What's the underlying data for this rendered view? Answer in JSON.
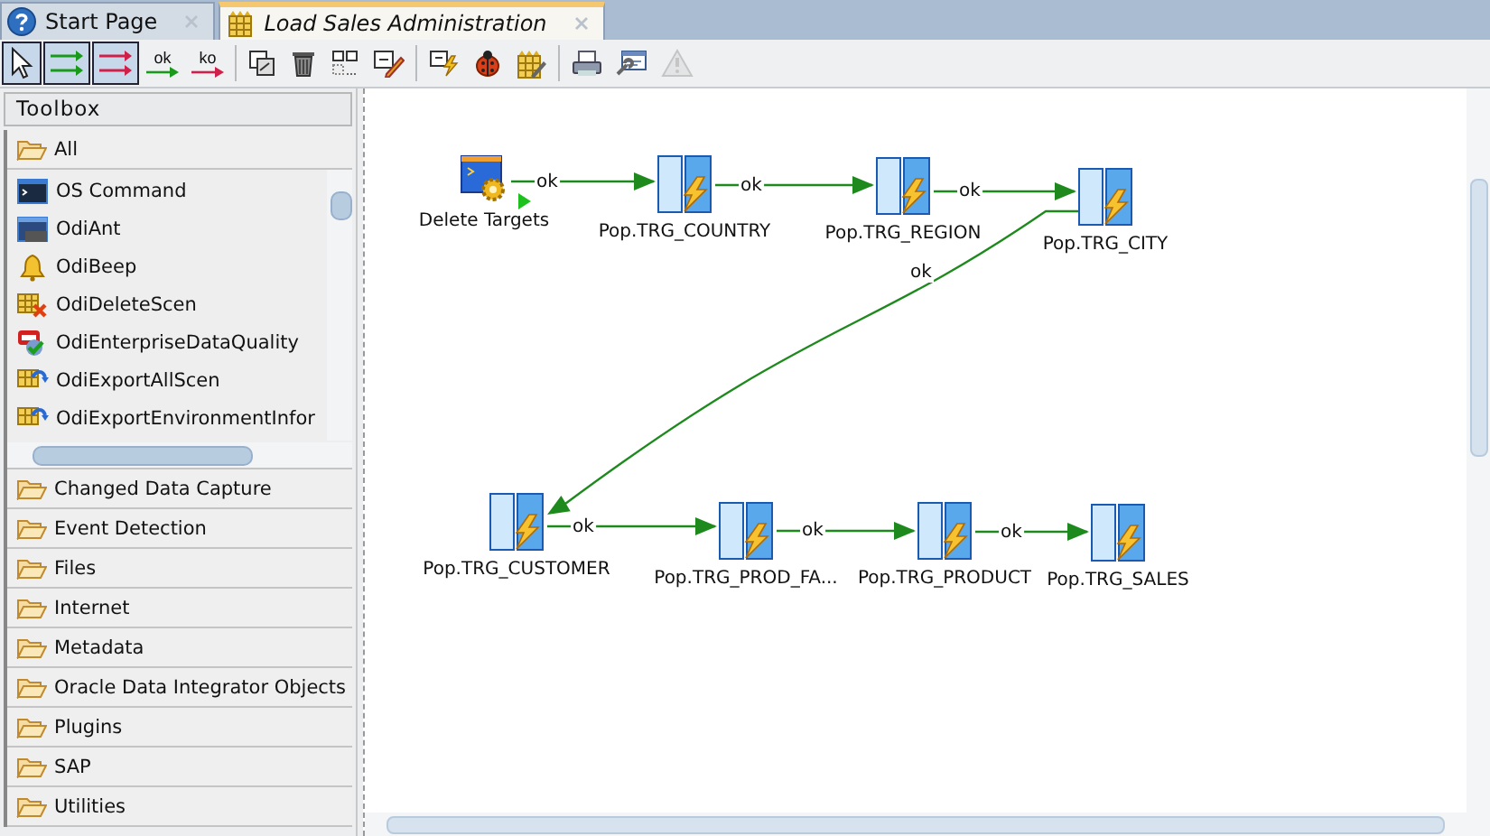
{
  "tabs": [
    {
      "label": "Start Page",
      "kind": "help",
      "selected": false
    },
    {
      "label": "Load Sales Administration",
      "kind": "package",
      "selected": true
    }
  ],
  "toolbar": {
    "buttons": [
      {
        "kind": "pointer",
        "selected": true,
        "disabled": false
      },
      {
        "kind": "link-ok-mode",
        "selected": true,
        "disabled": false
      },
      {
        "kind": "link-ko-mode",
        "selected": true,
        "disabled": false
      },
      {
        "kind": "ok-link",
        "label": "ok",
        "selected": false,
        "disabled": false
      },
      {
        "kind": "ko-link",
        "label": "ko",
        "selected": false,
        "disabled": false
      },
      {
        "kind": "separator"
      },
      {
        "kind": "duplicate",
        "selected": false,
        "disabled": false
      },
      {
        "kind": "delete",
        "selected": false,
        "disabled": false
      },
      {
        "kind": "arrange",
        "selected": false,
        "disabled": false
      },
      {
        "kind": "edit",
        "selected": false,
        "disabled": false
      },
      {
        "kind": "separator"
      },
      {
        "kind": "run",
        "selected": false,
        "disabled": false
      },
      {
        "kind": "debug",
        "selected": false,
        "disabled": false
      },
      {
        "kind": "scenario",
        "selected": false,
        "disabled": false
      },
      {
        "kind": "separator"
      },
      {
        "kind": "print",
        "selected": false,
        "disabled": false
      },
      {
        "kind": "properties",
        "selected": false,
        "disabled": false
      },
      {
        "kind": "warning",
        "selected": false,
        "disabled": true
      }
    ]
  },
  "toolbox": {
    "title": "Toolbox",
    "sections": [
      {
        "label": "All",
        "items": [
          {
            "label": "OS Command",
            "kind": "terminal"
          },
          {
            "label": "OdiAnt",
            "kind": "ant"
          },
          {
            "label": "OdiBeep",
            "kind": "bell"
          },
          {
            "label": "OdiDeleteScen",
            "kind": "delete-scen"
          },
          {
            "label": "OdiEnterpriseDataQuality",
            "kind": "quality"
          },
          {
            "label": "OdiExportAllScen",
            "kind": "export"
          },
          {
            "label": "OdiExportEnvironmentInfor",
            "kind": "export-env"
          }
        ]
      },
      {
        "label": "Changed Data Capture"
      },
      {
        "label": "Event Detection"
      },
      {
        "label": "Files"
      },
      {
        "label": "Internet"
      },
      {
        "label": "Metadata"
      },
      {
        "label": "Oracle Data Integrator Objects"
      },
      {
        "label": "Plugins"
      },
      {
        "label": "SAP"
      },
      {
        "label": "Utilities"
      }
    ]
  },
  "diagram": {
    "nodes": [
      {
        "label": "Delete Targets",
        "kind": "command",
        "start": true
      },
      {
        "label": "Pop.TRG_COUNTRY",
        "kind": "interface",
        "start": false
      },
      {
        "label": "Pop.TRG_REGION",
        "kind": "interface",
        "start": false
      },
      {
        "label": "Pop.TRG_CITY",
        "kind": "interface",
        "start": false
      },
      {
        "label": "Pop.TRG_CUSTOMER",
        "kind": "interface",
        "start": false
      },
      {
        "label": "Pop.TRG_PROD_FA...",
        "kind": "interface",
        "start": false
      },
      {
        "label": "Pop.TRG_PRODUCT",
        "kind": "interface",
        "start": false
      },
      {
        "label": "Pop.TRG_SALES",
        "kind": "interface",
        "start": false
      }
    ],
    "links": [
      {
        "label": "ok"
      },
      {
        "label": "ok"
      },
      {
        "label": "ok"
      },
      {
        "label": "ok"
      },
      {
        "label": "ok"
      },
      {
        "label": "ok"
      },
      {
        "label": "ok"
      }
    ]
  }
}
